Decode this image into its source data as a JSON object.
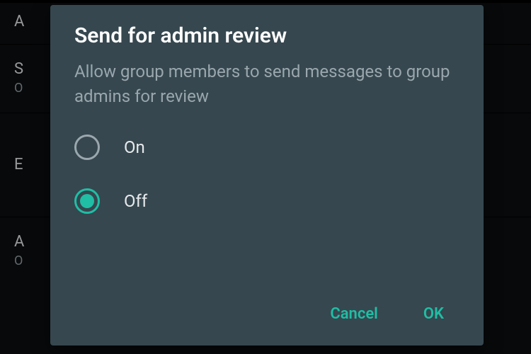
{
  "colors": {
    "dialog_bg": "#36474f",
    "accent": "#1fbea5",
    "text_primary": "#ffffff",
    "text_secondary": "#9aa7ad"
  },
  "background": {
    "rows": [
      {
        "label": "A",
        "sub": ""
      },
      {
        "label": "S",
        "sub": "O"
      },
      {
        "label": "E",
        "sub": ""
      },
      {
        "label": "A",
        "sub": "O"
      }
    ]
  },
  "dialog": {
    "title": "Send for admin review",
    "description": "Allow group members to send messages to group admins for review",
    "options": [
      {
        "label": "On",
        "selected": false
      },
      {
        "label": "Off",
        "selected": true
      }
    ],
    "actions": {
      "cancel": "Cancel",
      "ok": "OK"
    }
  }
}
